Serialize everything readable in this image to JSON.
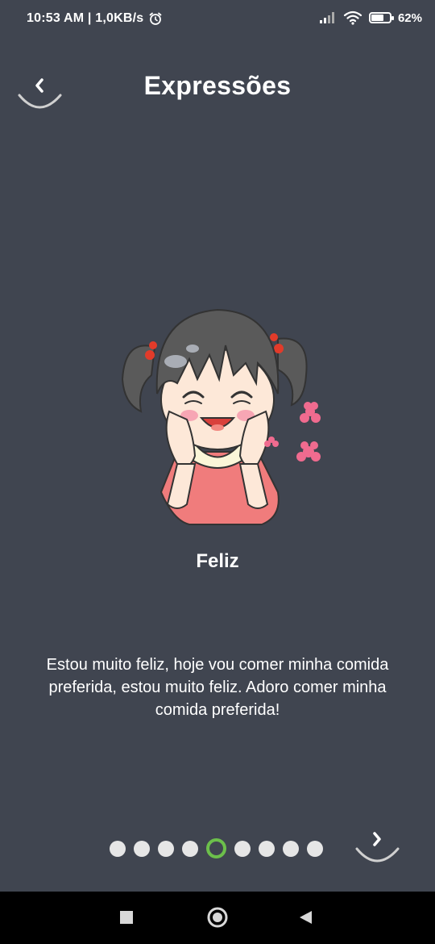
{
  "status_bar": {
    "time_speed": "10:53 AM | 1,0KB/s",
    "battery": "62%",
    "battery_level": 0.62,
    "icons": [
      "alarm-icon",
      "signal-icon",
      "wifi-icon",
      "battery-icon"
    ]
  },
  "header": {
    "title": "Expressões",
    "back_icon": "chevron-left-icon"
  },
  "card": {
    "name": "Feliz",
    "text": "Estou muito feliz, hoje vou comer minha comida preferida, estou muito feliz. Adoro comer minha comida preferida!"
  },
  "pager": {
    "total": 9,
    "current": 5,
    "active_color": "#6cbf4b",
    "next_icon": "chevron-right-icon"
  },
  "nav_bar": {
    "buttons": [
      "recents-square-icon",
      "home-circle-icon",
      "back-triangle-icon"
    ]
  },
  "colors": {
    "background": "#404550",
    "text": "#ffffff",
    "nav": "#000000"
  }
}
